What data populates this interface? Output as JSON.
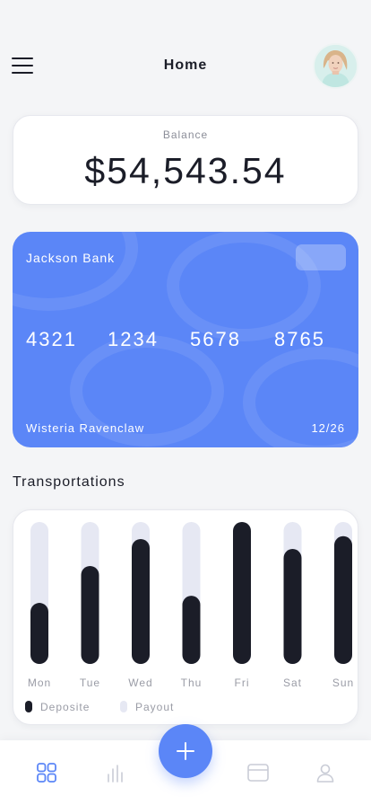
{
  "header": {
    "title": "Home",
    "menu_icon": "hamburger-menu-icon",
    "avatar": "user-avatar"
  },
  "balance": {
    "label": "Balance",
    "amount": "$54,543.54"
  },
  "card": {
    "bank_name": "Jackson Bank",
    "number_groups": [
      "4321",
      "1234",
      "5678",
      "8765"
    ],
    "holder": "Wisteria Ravenclaw",
    "expiry": "12/26",
    "color": "#5b86f7"
  },
  "transportations": {
    "title": "Transportations"
  },
  "chart_data": {
    "type": "bar",
    "categories": [
      "Mon",
      "Tue",
      "Wed",
      "Thu",
      "Fri",
      "Sat",
      "Sun"
    ],
    "series": [
      {
        "name": "Deposite",
        "color": "#1b1d28",
        "values": [
          43,
          69,
          88,
          48,
          100,
          81,
          90
        ]
      },
      {
        "name": "Payout",
        "color": "#e6e8f3",
        "values": [
          100,
          100,
          100,
          100,
          100,
          100,
          100
        ]
      }
    ],
    "ylim": [
      0,
      100
    ],
    "grid": false,
    "legend": "bottom-left"
  },
  "bottom_nav": {
    "items": [
      {
        "icon": "dashboard-grid-icon",
        "active": true
      },
      {
        "icon": "bar-chart-icon",
        "active": false
      },
      {
        "icon": "plus-icon",
        "active": false
      },
      {
        "icon": "credit-card-icon",
        "active": false
      },
      {
        "icon": "user-profile-icon",
        "active": false
      }
    ],
    "active_color": "#5b86f7",
    "inactive_color": "#c9ccd6"
  }
}
